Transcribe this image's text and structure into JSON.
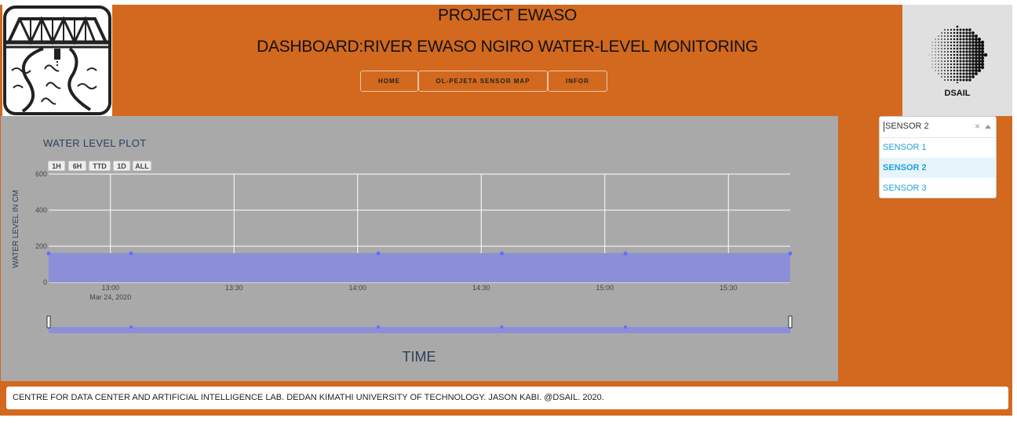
{
  "header": {
    "title": "PROJECT EWASO",
    "subtitle": "DASHBOARD:RIVER EWASO NGIRO WATER-LEVEL MONITORING",
    "right_logo_text": "DSAIL",
    "left_logo_icon": "bridge-river-sensor-icon",
    "right_logo_icon": "halftone-circle-icon"
  },
  "nav": [
    {
      "label": "HOME"
    },
    {
      "label": "OL-PEJETA SENSOR MAP"
    },
    {
      "label": "INFOR"
    }
  ],
  "sensor_select": {
    "value": "SENSOR 2",
    "clear_icon": "×",
    "options": [
      "SENSOR 1",
      "SENSOR 2",
      "SENSOR 3"
    ],
    "selected_index": 1
  },
  "plot": {
    "range_buttons": [
      "1H",
      "6H",
      "TTD",
      "1D",
      "ALL"
    ]
  },
  "footer": {
    "text": "CENTRE FOR DATA CENTER AND ARTIFICIAL INTELLIGENCE LAB. DEDAN KIMATHI UNIVERSITY OF TECHNOLOGY. JASON KABI. @DSAIL. 2020."
  },
  "colors": {
    "header_bg": "#d2691e",
    "plot_bg": "#a9a9a9",
    "series_fill": "#8a8fd8",
    "series_marker": "#636efa",
    "option_text": "#1fa3d6"
  },
  "chart_data": {
    "type": "area",
    "title": "WATER LEVEL PLOT",
    "xlabel": "TIME",
    "ylabel": "WATER LEVEL IN CM",
    "ylim": [
      0,
      600
    ],
    "y_ticks": [
      0,
      200,
      400,
      600
    ],
    "x_ticks": [
      "13:00",
      "13:30",
      "14:00",
      "14:30",
      "15:00",
      "15:30"
    ],
    "x_tick_sublabel": "Mar 24, 2020",
    "x_range": [
      "12:45",
      "15:45"
    ],
    "grid": true,
    "legend": "none",
    "rangeslider": true,
    "series": [
      {
        "x": [
          "12:45",
          "13:05",
          "13:35",
          "14:05",
          "14:35",
          "15:05",
          "15:35",
          "15:45"
        ],
        "y": [
          160,
          160,
          160,
          160,
          160,
          160,
          160,
          160
        ],
        "markers_at": [
          "12:45",
          "13:05",
          "14:05",
          "14:35",
          "15:05",
          "15:45"
        ]
      }
    ]
  }
}
